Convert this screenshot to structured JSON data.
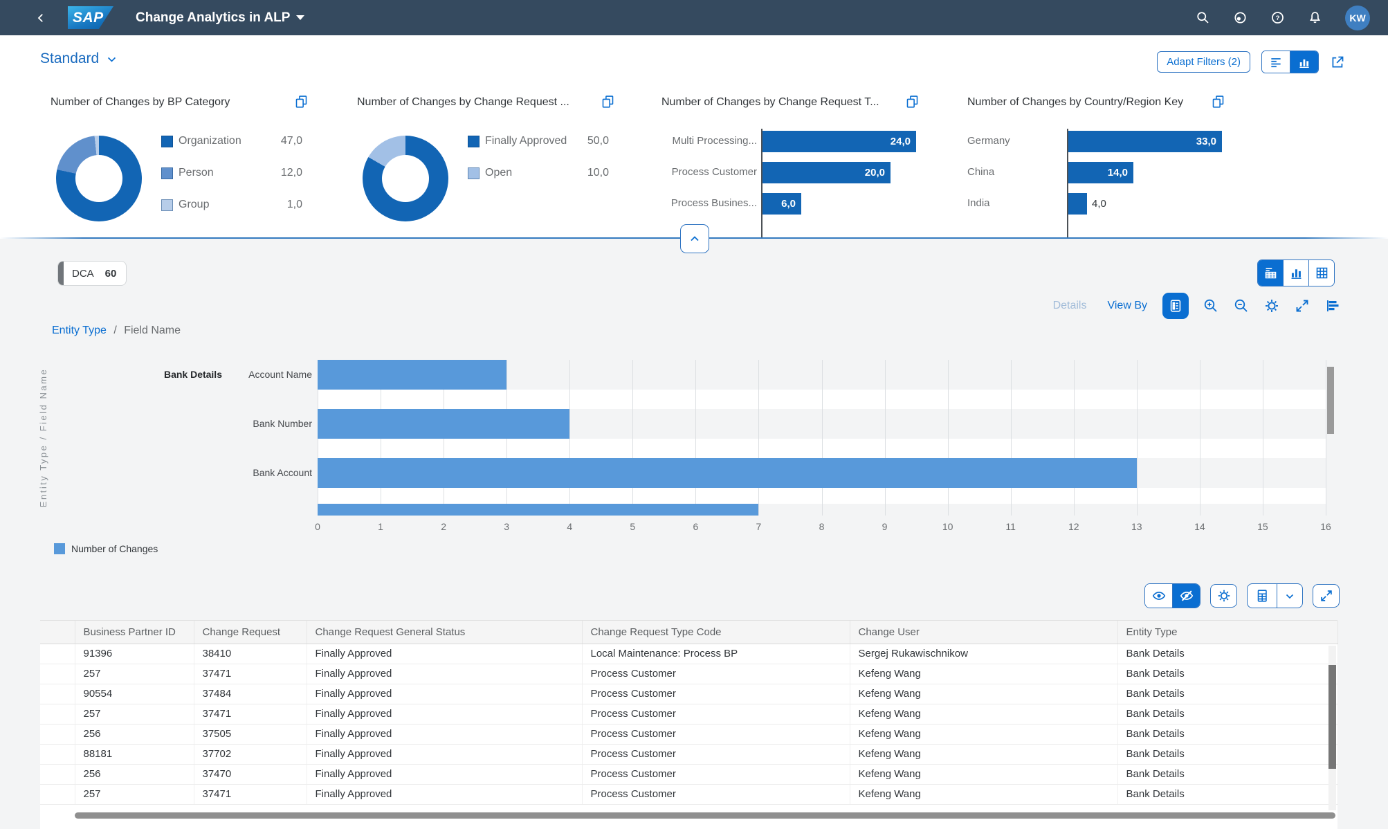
{
  "shell": {
    "logo_text": "SAP",
    "app_title": "Change Analytics in ALP",
    "avatar": "KW"
  },
  "variant": {
    "name": "Standard"
  },
  "filterbar": {
    "adapt_filters": "Adapt Filters (2)"
  },
  "cards": [
    {
      "title": "Number of Changes by BP Category",
      "type": "donut",
      "items": [
        {
          "label": "Organization",
          "value": "47,0",
          "num": 47,
          "color": "#1265b4"
        },
        {
          "label": "Person",
          "value": "12,0",
          "num": 12,
          "color": "#6090cc"
        },
        {
          "label": "Group",
          "value": "1,0",
          "num": 1,
          "color": "#b7cde9"
        }
      ]
    },
    {
      "title": "Number of Changes by Change Request ...",
      "type": "donut",
      "items": [
        {
          "label": "Finally Approved",
          "value": "50,0",
          "num": 50,
          "color": "#1265b4"
        },
        {
          "label": "Open",
          "value": "10,0",
          "num": 10,
          "color": "#a2c0e6"
        }
      ]
    },
    {
      "title": "Number of Changes by Change Request T...",
      "type": "bar",
      "label_align": "right",
      "bar_color": "#1265b4",
      "items": [
        {
          "label": "Multi Processing...",
          "value": "24,0",
          "num": 24
        },
        {
          "label": "Process Customer",
          "value": "20,0",
          "num": 20
        },
        {
          "label": "Process Busines...",
          "value": "6,0",
          "num": 6
        }
      ]
    },
    {
      "title": "Number of Changes by Country/Region Key",
      "type": "bar",
      "label_align": "left",
      "bar_color": "#1265b4",
      "items": [
        {
          "label": "Germany",
          "value": "33,0",
          "num": 33
        },
        {
          "label": "China",
          "value": "14,0",
          "num": 14
        },
        {
          "label": "India",
          "value": "4,0",
          "num": 4
        }
      ]
    }
  ],
  "chip": {
    "label": "DCA",
    "value": "60"
  },
  "chart_toolbar": {
    "details": "Details",
    "view_by": "View By"
  },
  "breadcrumb": {
    "link": "Entity Type",
    "separator": "/",
    "current": "Field Name"
  },
  "chart_data": {
    "type": "bar",
    "orientation": "horizontal",
    "group_label": "Bank Details",
    "categories": [
      "Account Name",
      "Bank Number",
      "Bank Account"
    ],
    "values": [
      3,
      4,
      13
    ],
    "partial_bar_value": 7,
    "xlim": [
      0,
      16
    ],
    "xtick_interval": 1,
    "xlabel": "",
    "ylabel": "Entity Type / Field Name",
    "grid": true,
    "bar_color": "#5899DA",
    "legend": [
      {
        "label": "Number of Changes",
        "color": "#5899DA"
      }
    ]
  },
  "table": {
    "columns": [
      "Business Partner ID",
      "Change Request",
      "Change Request General Status",
      "Change Request Type Code",
      "Change User",
      "Entity Type"
    ],
    "rows": [
      [
        "91396",
        "38410",
        "Finally Approved",
        "Local Maintenance: Process BP",
        "Sergej Rukawischnikow",
        "Bank Details"
      ],
      [
        "257",
        "37471",
        "Finally Approved",
        "Process Customer",
        "Kefeng Wang",
        "Bank Details"
      ],
      [
        "90554",
        "37484",
        "Finally Approved",
        "Process Customer",
        "Kefeng Wang",
        "Bank Details"
      ],
      [
        "257",
        "37471",
        "Finally Approved",
        "Process Customer",
        "Kefeng Wang",
        "Bank Details"
      ],
      [
        "256",
        "37505",
        "Finally Approved",
        "Process Customer",
        "Kefeng Wang",
        "Bank Details"
      ],
      [
        "88181",
        "37702",
        "Finally Approved",
        "Process Customer",
        "Kefeng Wang",
        "Bank Details"
      ],
      [
        "256",
        "37470",
        "Finally Approved",
        "Process Customer",
        "Kefeng Wang",
        "Bank Details"
      ],
      [
        "257",
        "37471",
        "Finally Approved",
        "Process Customer",
        "Kefeng Wang",
        "Bank Details"
      ]
    ]
  }
}
